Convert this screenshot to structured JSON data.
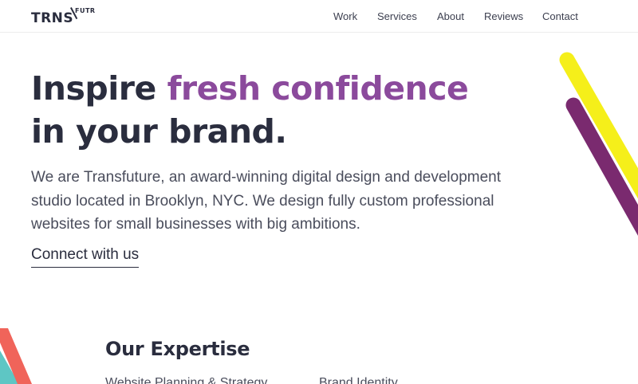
{
  "brand": {
    "logo_main": "TRNS",
    "logo_sub": "FUTR"
  },
  "nav": {
    "items": [
      {
        "label": "Work"
      },
      {
        "label": "Services"
      },
      {
        "label": "About"
      },
      {
        "label": "Reviews"
      },
      {
        "label": "Contact"
      }
    ]
  },
  "hero": {
    "title_part1": "Inspire ",
    "title_accent": "fresh confidence",
    "title_part2": "in your brand.",
    "description": "We are Transfuture, an award-winning digital design and development studio located in Brooklyn, NYC. We design fully custom professional websites for small businesses with big ambitions.",
    "cta_label": "Connect with us"
  },
  "expertise": {
    "title": "Our Expertise",
    "items": [
      {
        "label": "Website Planning & Strategy"
      },
      {
        "label": "Brand Identity"
      }
    ]
  },
  "colors": {
    "text_dark": "#2a2d3e",
    "accent_purple": "#8b4a9c",
    "stripe_yellow": "#f5ef1a",
    "stripe_purple": "#7a2a6f",
    "stripe_coral": "#f0645a",
    "stripe_teal": "#5ec6c4"
  }
}
